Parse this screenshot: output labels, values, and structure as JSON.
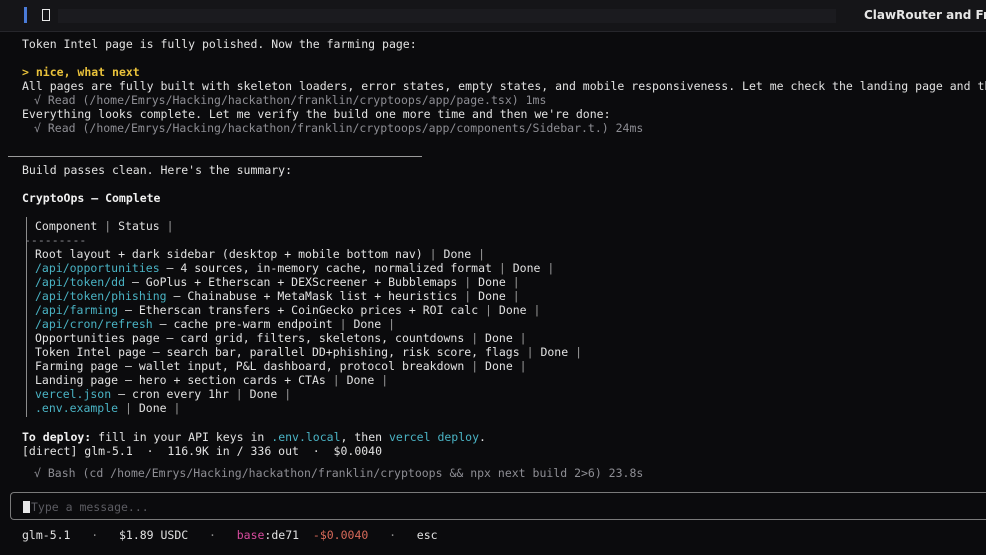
{
  "topbar": {
    "title": "ClawRouter and Fra"
  },
  "messages": {
    "l1": "Token Intel page is fully polished. Now the farming page:",
    "prompt_marker": ">",
    "prompt": "nice, what next",
    "l3": "All pages are fully built with skeleton loaders, error states, empty states, and mobile responsiveness. Let me check the landing page and th",
    "l4_check": "√",
    "l4": "Read (/home/Emrys/Hacking/hackathon/franklin/cryptoops/app/page.tsx) 1ms",
    "l5": "Everything looks complete. Let me verify the build one more time and then we're done:",
    "l6_check": "√",
    "l6": "Read (/home/Emrys/Hacking/hackathon/franklin/cryptoops/app/components/Sidebar.t.) 24ms",
    "l7": "Build passes clean. Here's the summary:",
    "heading": "CryptoOps — Complete"
  },
  "table": {
    "header": [
      "Component",
      "Status"
    ],
    "divider": "---------",
    "rows": [
      {
        "prefix": "",
        "text": "Root layout + dark sidebar (desktop + mobile bottom nav)",
        "status": "Done"
      },
      {
        "prefix": "/api/opportunities",
        "text": " — 4 sources, in-memory cache, normalized format",
        "status": "Done"
      },
      {
        "prefix": "/api/token/dd",
        "text": " — GoPlus + Etherscan + DEXScreener + Bubblemaps",
        "status": "Done"
      },
      {
        "prefix": "/api/token/phishing",
        "text": " — Chainabuse + MetaMask list + heuristics",
        "status": "Done"
      },
      {
        "prefix": "/api/farming",
        "text": " — Etherscan transfers + CoinGecko prices + ROI calc",
        "status": "Done"
      },
      {
        "prefix": "/api/cron/refresh",
        "text": " — cache pre-warm endpoint",
        "status": "Done"
      },
      {
        "prefix": "",
        "text": "Opportunities page — card grid, filters, skeletons, countdowns",
        "status": "Done"
      },
      {
        "prefix": "",
        "text": "Token Intel page — search bar, parallel DD+phishing, risk score, flags",
        "status": "Done"
      },
      {
        "prefix": "",
        "text": "Farming page — wallet input, P&L dashboard, protocol breakdown",
        "status": "Done"
      },
      {
        "prefix": "",
        "text": "Landing page — hero + section cards + CTAs",
        "status": "Done"
      },
      {
        "prefix": "vercel.json",
        "text": " — cron every 1hr",
        "status": "Done"
      },
      {
        "prefix": ".env.example",
        "text": "",
        "status": "Done"
      }
    ]
  },
  "deploy": {
    "label": "To deploy:",
    "t1": " fill in your API keys in ",
    "file": ".env.local",
    "t2": ", then ",
    "cmd": "vercel deploy",
    "t3": "."
  },
  "usage": "[direct] glm-5.1  ·  116.9K in / 336 out  ·  $0.0040",
  "bash": {
    "check": "√",
    "text": "Bash (cd /home/Emrys/Hacking/hackathon/franklin/cryptoops && npx next build 2>6) 23.8s"
  },
  "input": {
    "placeholder": "Type a message..."
  },
  "status": {
    "model": "glm-5.1",
    "dot": "·",
    "balance": "$1.89 USDC",
    "base_label": "base",
    "base_hash": ":de71",
    "cost": "-$0.0040",
    "esc": "esc"
  }
}
